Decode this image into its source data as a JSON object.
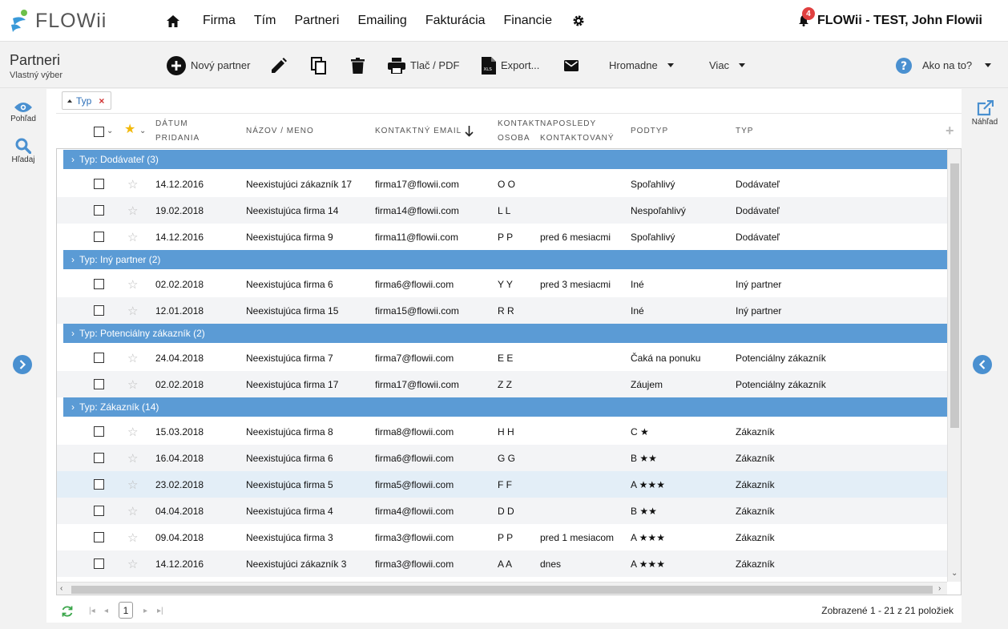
{
  "app": {
    "logo": "FLOWii",
    "nav": [
      "Firma",
      "Tím",
      "Partneri",
      "Emailing",
      "Fakturácia",
      "Financie"
    ],
    "notifications": "4",
    "user": "FLOWii - TEST, John Flowii"
  },
  "page": {
    "title": "Partneri",
    "subtitle": "Vlastný výber"
  },
  "toolbar": {
    "new_partner": "Nový partner",
    "print": "Tlač / PDF",
    "export": "Export...",
    "bulk": "Hromadne",
    "more": "Viac",
    "help": "Ako na to?"
  },
  "left_rail": {
    "view": "Pohľad",
    "search": "Hľadaj"
  },
  "right_rail": {
    "preview": "Náhľad"
  },
  "filter": {
    "chip": "Typ"
  },
  "columns": {
    "date_line1": "Dátum",
    "date_line2": "pridania",
    "name": "Názov / Meno",
    "email": "Kontaktný email",
    "contact_line1": "Kontakt",
    "contact_line2": "osoba",
    "last_line1": "Naposledy",
    "last_line2": "kontaktovaný",
    "subtype": "Podtyp",
    "type": "Typ"
  },
  "groups": [
    {
      "label": "Typ: Dodávateľ (3)",
      "rows": [
        {
          "date": "14.12.2016",
          "name": "Neexistujúci zákazník 17",
          "email": "firma17@flowii.com",
          "contact": "O O",
          "last": "",
          "subtype": "Spoľahlivý",
          "type": "Dodávateľ"
        },
        {
          "date": "19.02.2018",
          "name": "Neexistujúca firma 14",
          "email": "firma14@flowii.com",
          "contact": "L L",
          "last": "",
          "subtype": "Nespoľahlivý",
          "type": "Dodávateľ"
        },
        {
          "date": "14.12.2016",
          "name": "Neexistujúca firma 9",
          "email": "firma11@flowii.com",
          "contact": "P P",
          "last": "pred 6 mesiacmi",
          "subtype": "Spoľahlivý",
          "type": "Dodávateľ"
        }
      ]
    },
    {
      "label": "Typ: Iný partner (2)",
      "rows": [
        {
          "date": "02.02.2018",
          "name": "Neexistujúca firma 6",
          "email": "firma6@flowii.com",
          "contact": "Y Y",
          "last": "pred 3 mesiacmi",
          "subtype": "Iné",
          "type": "Iný partner"
        },
        {
          "date": "12.01.2018",
          "name": "Neexistujúca firma 15",
          "email": "firma15@flowii.com",
          "contact": "R R",
          "last": "",
          "subtype": "Iné",
          "type": "Iný partner"
        }
      ]
    },
    {
      "label": "Typ: Potenciálny zákazník (2)",
      "rows": [
        {
          "date": "24.04.2018",
          "name": "Neexistujúca firma 7",
          "email": "firma7@flowii.com",
          "contact": "E E",
          "last": "",
          "subtype": "Čaká na ponuku",
          "type": "Potenciálny zákazník"
        },
        {
          "date": "02.02.2018",
          "name": "Neexistujúca firma 17",
          "email": "firma17@flowii.com",
          "contact": "Z Z",
          "last": "",
          "subtype": "Záujem",
          "type": "Potenciálny zákazník"
        }
      ]
    },
    {
      "label": "Typ: Zákazník (14)",
      "rows": [
        {
          "date": "15.03.2018",
          "name": "Neexistujúca firma 8",
          "email": "firma8@flowii.com",
          "contact": "H H",
          "last": "",
          "subtype": "C ★",
          "type": "Zákazník"
        },
        {
          "date": "16.04.2018",
          "name": "Neexistujúca firma 6",
          "email": "firma6@flowii.com",
          "contact": "G G",
          "last": "",
          "subtype": "B ★★",
          "type": "Zákazník"
        },
        {
          "date": "23.02.2018",
          "name": "Neexistujúca firma 5",
          "email": "firma5@flowii.com",
          "contact": "F F",
          "last": "",
          "subtype": "A ★★★",
          "type": "Zákazník"
        },
        {
          "date": "04.04.2018",
          "name": "Neexistujúca firma 4",
          "email": "firma4@flowii.com",
          "contact": "D D",
          "last": "",
          "subtype": "B ★★",
          "type": "Zákazník"
        },
        {
          "date": "09.04.2018",
          "name": "Neexistujúca firma 3",
          "email": "firma3@flowii.com",
          "contact": "P P",
          "last": "pred 1 mesiacom",
          "subtype": "A ★★★",
          "type": "Zákazník"
        },
        {
          "date": "14.12.2016",
          "name": "Neexistujúci zákazník 3",
          "email": "firma3@flowii.com",
          "contact": "A A",
          "last": "dnes",
          "subtype": "A ★★★",
          "type": "Zákazník"
        }
      ]
    }
  ],
  "pager": {
    "page": "1",
    "summary": "Zobrazené 1 - 21 z 21 položiek"
  },
  "colors": {
    "accent": "#4a90d0",
    "group": "#5b9bd5",
    "badge": "#e04040",
    "refresh": "#3aa64a"
  }
}
